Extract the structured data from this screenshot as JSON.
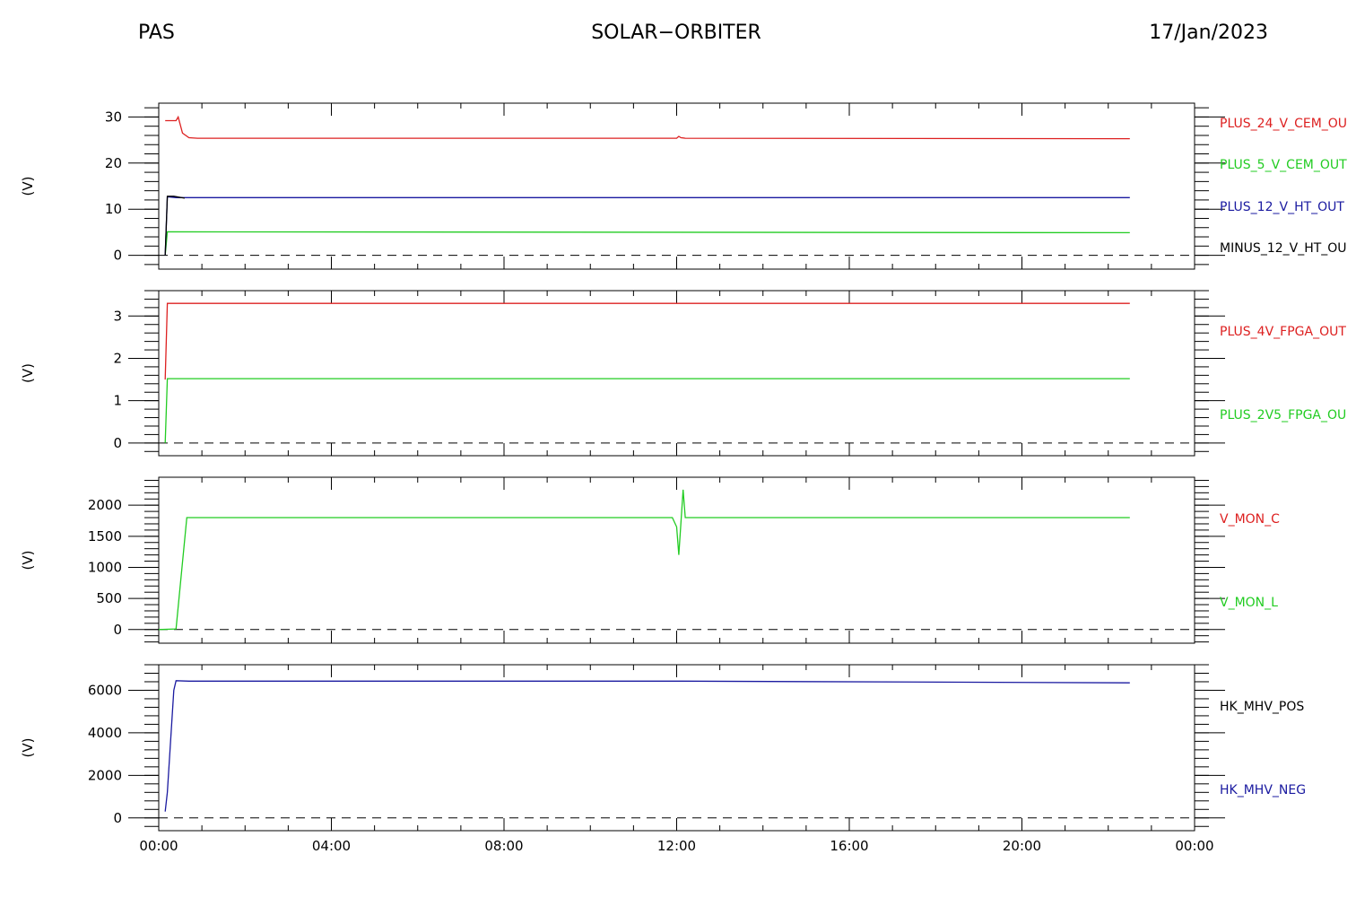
{
  "header": {
    "left": "PAS",
    "center": "SOLAR−ORBITER",
    "right": "17/Jan/2023"
  },
  "chart_data": [
    {
      "type": "line",
      "ylabel": "(V)",
      "ylim": [
        -3,
        33
      ],
      "yticks": [
        0,
        10,
        20,
        30
      ],
      "ytick_labels": [
        "0",
        "10",
        "20",
        "30"
      ],
      "xlim": [
        0,
        24
      ],
      "zero_line": "dashed",
      "legend_placement": "right",
      "series": [
        {
          "name": "PLUS_24_V_CEM_OU",
          "color": "#dd2020",
          "x": [
            0.15,
            0.4,
            0.45,
            0.55,
            0.7,
            0.9,
            12.0,
            12.05,
            12.1,
            12.2,
            22.5
          ],
          "y": [
            29.2,
            29.2,
            30.0,
            26.5,
            25.5,
            25.4,
            25.4,
            25.8,
            25.5,
            25.4,
            25.3
          ]
        },
        {
          "name": "PLUS_5_V_CEM_OUT",
          "color": "#22cc22",
          "x": [
            0.15,
            0.2,
            22.5
          ],
          "y": [
            0,
            5.1,
            4.9
          ]
        },
        {
          "name": "PLUS_12_V_HT_OUT",
          "color": "#1a1aa0",
          "x": [
            0.15,
            0.2,
            0.4,
            22.5
          ],
          "y": [
            0,
            12.7,
            12.5,
            12.5
          ]
        },
        {
          "name": "MINUS_12_V_HT_OU",
          "color": "#000000",
          "x": [
            0.15,
            0.2,
            0.35,
            0.6
          ],
          "y": [
            0,
            12.8,
            12.8,
            12.4
          ]
        }
      ]
    },
    {
      "type": "line",
      "ylabel": "(V)",
      "ylim": [
        -0.3,
        3.6
      ],
      "yticks": [
        0,
        1,
        2,
        3
      ],
      "ytick_labels": [
        "0",
        "1",
        "2",
        "3"
      ],
      "xlim": [
        0,
        24
      ],
      "zero_line": "dashed",
      "legend_placement": "right",
      "series": [
        {
          "name": "PLUS_4V_FPGA_OUT",
          "color": "#dd2020",
          "x": [
            0.15,
            0.2,
            22.5
          ],
          "y": [
            1.5,
            3.3,
            3.3
          ]
        },
        {
          "name": "PLUS_2V5_FPGA_OU",
          "color": "#22cc22",
          "x": [
            0.15,
            0.2,
            22.5
          ],
          "y": [
            0,
            1.52,
            1.52
          ]
        }
      ]
    },
    {
      "type": "line",
      "ylabel": "(V)",
      "ylim": [
        -220,
        2450
      ],
      "yticks": [
        0,
        500,
        1000,
        1500,
        2000
      ],
      "ytick_labels": [
        "0",
        "500",
        "1000",
        "1500",
        "2000"
      ],
      "xlim": [
        0,
        24
      ],
      "zero_line": "dashed",
      "legend_placement": "right",
      "series": [
        {
          "name": "V_MON_C",
          "color": "#dd2020",
          "x": [],
          "y": []
        },
        {
          "name": "V_MON_L",
          "color": "#22cc22",
          "x": [
            0.0,
            0.4,
            0.65,
            0.7,
            11.9,
            12.0,
            12.05,
            12.15,
            12.2,
            12.25,
            22.5
          ],
          "y": [
            0,
            10,
            1800,
            1800,
            1800,
            1650,
            1200,
            2250,
            1800,
            1800,
            1800
          ]
        }
      ]
    },
    {
      "type": "line",
      "ylabel": "(V)",
      "ylim": [
        -600,
        7200
      ],
      "yticks": [
        0,
        2000,
        4000,
        6000
      ],
      "ytick_labels": [
        "0",
        "2000",
        "4000",
        "6000"
      ],
      "xlim": [
        0,
        24
      ],
      "zero_line": "dashed",
      "legend_placement": "right",
      "xticks": [
        0,
        4,
        8,
        12,
        16,
        20,
        24
      ],
      "xtick_labels": [
        "00:00",
        "04:00",
        "08:00",
        "12:00",
        "16:00",
        "20:00",
        "00:00"
      ],
      "series": [
        {
          "name": "HK_MHV_POS",
          "color": "#000000",
          "x": [],
          "y": []
        },
        {
          "name": "HK_MHV_NEG",
          "color": "#1a1aa0",
          "x": [
            0.15,
            0.2,
            0.35,
            0.4,
            0.7,
            12.0,
            22.5
          ],
          "y": [
            300,
            1200,
            6000,
            6450,
            6430,
            6430,
            6350
          ]
        }
      ]
    }
  ]
}
